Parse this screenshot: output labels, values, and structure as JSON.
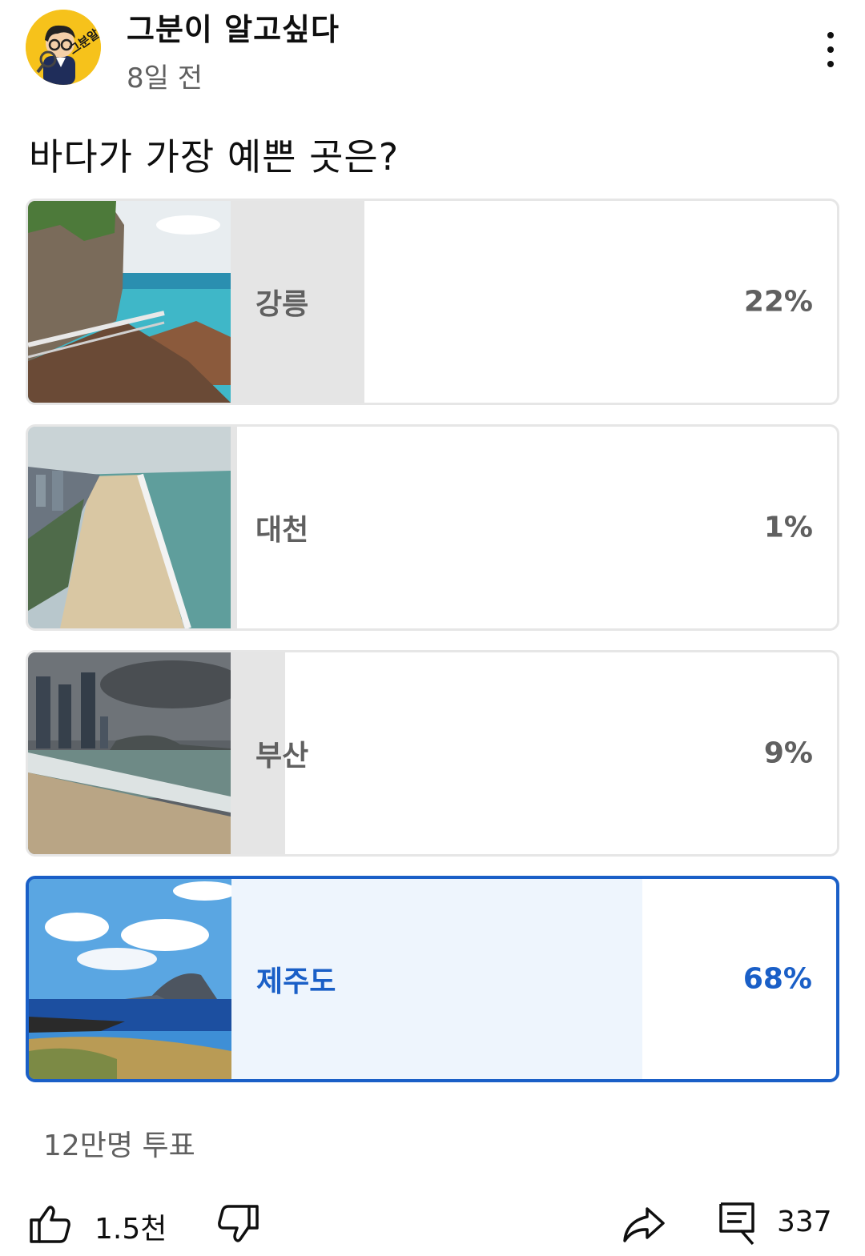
{
  "header": {
    "channel_name": "그분이 알고싶다",
    "avatar_text": "그분알",
    "post_time": "8일 전"
  },
  "poll": {
    "question": "바다가 가장 예쁜 곳은?",
    "options": [
      {
        "label": "강릉",
        "percent_label": "22%",
        "percent": 22,
        "selected": false
      },
      {
        "label": "대천",
        "percent_label": "1%",
        "percent": 1,
        "selected": false
      },
      {
        "label": "부산",
        "percent_label": "9%",
        "percent": 9,
        "selected": false
      },
      {
        "label": "제주도",
        "percent_label": "68%",
        "percent": 68,
        "selected": true
      }
    ],
    "total_votes": "12만명 투표"
  },
  "actions": {
    "like_count": "1.5천",
    "comment_count": "337"
  },
  "colors": {
    "selected": "#1a5fc7",
    "selected_fill": "#eef5fd",
    "unselected_fill": "#e5e5e5"
  }
}
